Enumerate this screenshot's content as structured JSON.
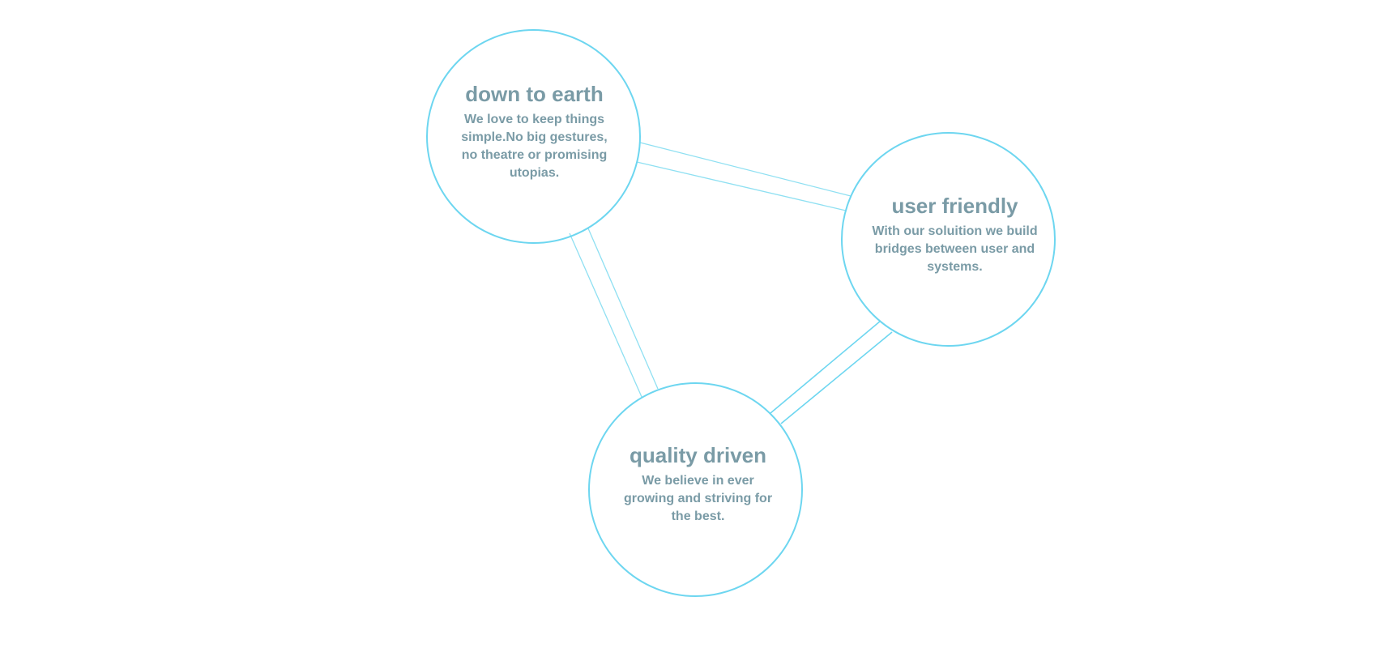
{
  "theme": {
    "circle_color": "#6dd6f0",
    "line_color": "#8fe0f2",
    "text_color": "#7a9ba6"
  },
  "nodes": [
    {
      "title": "down to earth",
      "text": "We love to keep things simple.No big gestures, no theatre or promising utopias."
    },
    {
      "title": "user friendly",
      "text": "With our soluition we build bridges between user and systems."
    },
    {
      "title": "quality driven",
      "text": "We believe in ever growing and striving for the best."
    }
  ]
}
